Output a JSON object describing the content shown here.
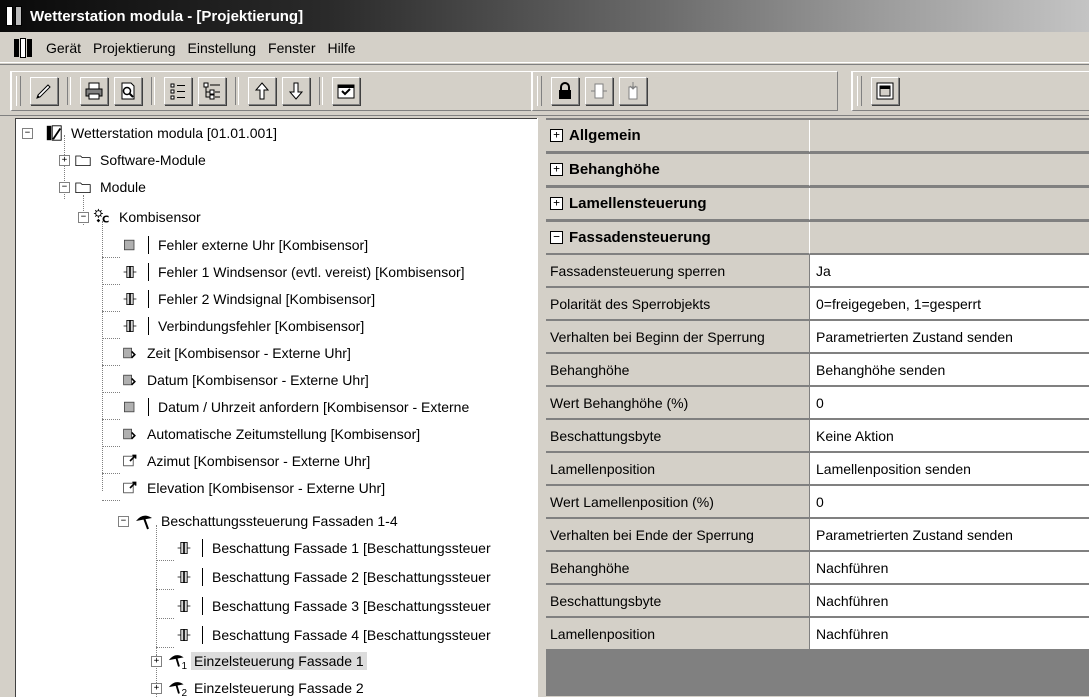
{
  "window": {
    "title": "Wetterstation modula  - [Projektierung]"
  },
  "menu": {
    "items": [
      "Gerät",
      "Projektierung",
      "Einstellung",
      "Fenster",
      "Hilfe"
    ]
  },
  "toolbar": {
    "group1_icons": [
      "pencil-icon",
      "print-icon",
      "print-preview-icon",
      "list-icon",
      "tree-list-icon",
      "arrow-up-icon",
      "arrow-down-icon",
      "program-icon"
    ],
    "group2_icons": [
      "lock-icon",
      "object-icon",
      "object-insert-icon"
    ],
    "group3_icons": [
      "window-icon"
    ]
  },
  "tree": {
    "root": "Wetterstation modula [01.01.001]",
    "software_modules": "Software-Module",
    "modules": "Module",
    "kombisensor": "Kombisensor",
    "objects": [
      "Fehler externe Uhr [Kombisensor]",
      "Fehler 1 Windsensor (evtl. vereist) [Kombisensor]",
      "Fehler 2 Windsignal [Kombisensor]",
      "Verbindungsfehler [Kombisensor]",
      "Zeit [Kombisensor - Externe Uhr]",
      "Datum [Kombisensor - Externe Uhr]",
      "Datum / Uhrzeit anfordern [Kombisensor - Externe",
      "Automatische Zeitumstellung [Kombisensor]",
      "Azimut [Kombisensor - Externe Uhr]",
      "Elevation [Kombisensor - Externe Uhr]"
    ],
    "shading_group": "Beschattungssteuerung Fassaden 1-4",
    "shading_items": [
      "Beschattung Fassade 1 [Beschattungssteuer",
      "Beschattung Fassade 2 [Beschattungssteuer",
      "Beschattung Fassade 3 [Beschattungssteuer",
      "Beschattung Fassade 4 [Beschattungssteuer"
    ],
    "single_1": "Einzelsteuerung Fassade 1",
    "single_1_sub": "1",
    "single_2": "Einzelsteuerung Fassade 2",
    "single_2_sub": "2"
  },
  "properties": {
    "categories": [
      {
        "label": "Allgemein",
        "state": "+"
      },
      {
        "label": "Behanghöhe",
        "state": "+"
      },
      {
        "label": "Lamellensteuerung",
        "state": "+"
      },
      {
        "label": "Fassadensteuerung",
        "state": "−"
      }
    ],
    "rows": [
      {
        "name": "Fassadensteuerung sperren",
        "value": "Ja"
      },
      {
        "name": "Polarität des Sperrobjekts",
        "value": "0=freigegeben, 1=gesperrt"
      },
      {
        "name": "Verhalten bei Beginn der Sperrung",
        "value": "Parametrierten Zustand senden"
      },
      {
        "name": "Behanghöhe",
        "value": "Behanghöhe senden"
      },
      {
        "name": "Wert Behanghöhe (%)",
        "value": "0"
      },
      {
        "name": "Beschattungsbyte",
        "value": "Keine Aktion"
      },
      {
        "name": "Lamellenposition",
        "value": "Lamellenposition senden"
      },
      {
        "name": "Wert Lamellenposition (%)",
        "value": "0"
      },
      {
        "name": "Verhalten bei Ende der Sperrung",
        "value": "Parametrierten Zustand senden"
      },
      {
        "name": "Behanghöhe",
        "value": "Nachführen"
      },
      {
        "name": "Beschattungsbyte",
        "value": "Nachführen"
      },
      {
        "name": "Lamellenposition",
        "value": "Nachführen"
      }
    ]
  }
}
